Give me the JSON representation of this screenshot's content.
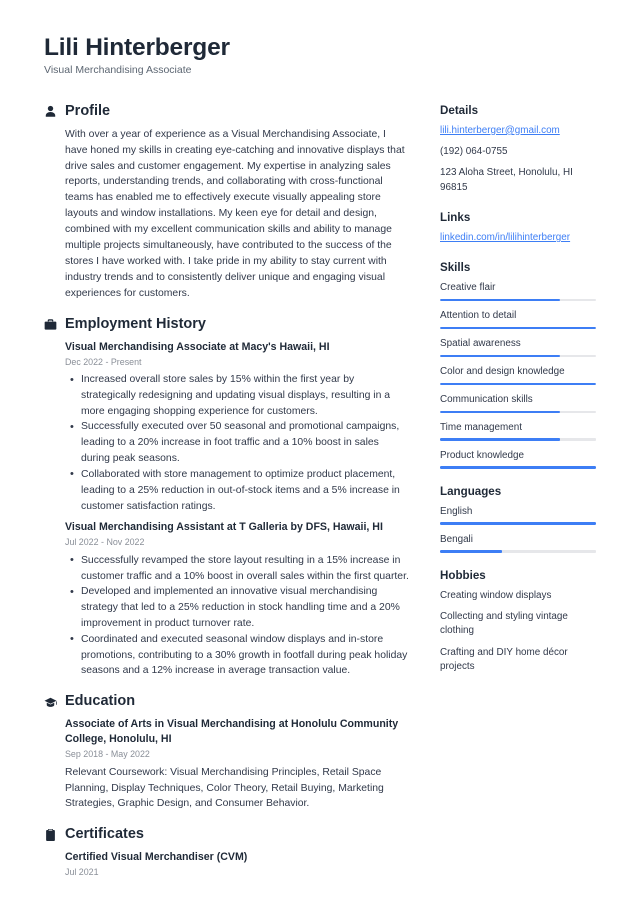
{
  "header": {
    "name": "Lili Hinterberger",
    "job_title": "Visual Merchandising Associate"
  },
  "accent_color": "#3d7ef5",
  "text_color": "#31394a",
  "heading_color": "#1f2937",
  "muted_color": "#8a8f98",
  "main": {
    "profile": {
      "icon": "user-icon",
      "title": "Profile",
      "text": "With over a year of experience as a Visual Merchandising Associate, I have honed my skills in creating eye-catching and innovative displays that drive sales and customer engagement. My expertise in analyzing sales reports, understanding trends, and collaborating with cross-functional teams has enabled me to effectively execute visually appealing store layouts and window installations. My keen eye for detail and design, combined with my excellent communication skills and ability to manage multiple projects simultaneously, have contributed to the success of the stores I have worked with. I take pride in my ability to stay current with industry trends and to consistently deliver unique and engaging visual experiences for customers."
    },
    "employment": {
      "icon": "briefcase-icon",
      "title": "Employment History",
      "entries": [
        {
          "title": "Visual Merchandising Associate at Macy's Hawaii, HI",
          "date": "Dec 2022 - Present",
          "bullets": [
            "Increased overall store sales by 15% within the first year by strategically redesigning and updating visual displays, resulting in a more engaging shopping experience for customers.",
            "Successfully executed over 50 seasonal and promotional campaigns, leading to a 20% increase in foot traffic and a 10% boost in sales during peak seasons.",
            "Collaborated with store management to optimize product placement, leading to a 25% reduction in out-of-stock items and a 5% increase in customer satisfaction ratings."
          ]
        },
        {
          "title": "Visual Merchandising Assistant at T Galleria by DFS, Hawaii, HI",
          "date": "Jul 2022 - Nov 2022",
          "bullets": [
            "Successfully revamped the store layout resulting in a 15% increase in customer traffic and a 10% boost in overall sales within the first quarter.",
            "Developed and implemented an innovative visual merchandising strategy that led to a 25% reduction in stock handling time and a 20% improvement in product turnover rate.",
            "Coordinated and executed seasonal window displays and in-store promotions, contributing to a 30% growth in footfall during peak holiday seasons and a 12% increase in average transaction value."
          ]
        }
      ]
    },
    "education": {
      "icon": "graduation-cap-icon",
      "title": "Education",
      "entries": [
        {
          "title": "Associate of Arts in Visual Merchandising at Honolulu Community College, Honolulu, HI",
          "date": "Sep 2018 - May 2022",
          "description": "Relevant Coursework: Visual Merchandising Principles, Retail Space Planning, Display Techniques, Color Theory, Retail Buying, Marketing Strategies, Graphic Design, and Consumer Behavior."
        }
      ]
    },
    "certificates": {
      "icon": "certificate-icon",
      "title": "Certificates",
      "entries": [
        {
          "title": "Certified Visual Merchandiser (CVM)",
          "date": "Jul 2021"
        }
      ]
    }
  },
  "sidebar": {
    "details": {
      "title": "Details",
      "email": "lili.hinterberger@gmail.com",
      "phone": "(192) 064-0755",
      "address": "123 Aloha Street, Honolulu, HI 96815"
    },
    "links": {
      "title": "Links",
      "items": [
        {
          "label": "linkedin.com/in/lilihinterberger"
        }
      ]
    },
    "skills": {
      "title": "Skills",
      "items": [
        {
          "label": "Creative flair",
          "level": 77
        },
        {
          "label": "Attention to detail",
          "level": 100
        },
        {
          "label": "Spatial awareness",
          "level": 77
        },
        {
          "label": "Color and design knowledge",
          "level": 100
        },
        {
          "label": "Communication skills",
          "level": 77
        },
        {
          "label": "Time management",
          "level": 77
        },
        {
          "label": "Product knowledge",
          "level": 100
        }
      ]
    },
    "languages": {
      "title": "Languages",
      "items": [
        {
          "label": "English",
          "level": 100
        },
        {
          "label": "Bengali",
          "level": 40
        }
      ]
    },
    "hobbies": {
      "title": "Hobbies",
      "items": [
        {
          "label": "Creating window displays"
        },
        {
          "label": "Collecting and styling vintage clothing"
        },
        {
          "label": "Crafting and DIY home décor projects"
        }
      ]
    }
  }
}
